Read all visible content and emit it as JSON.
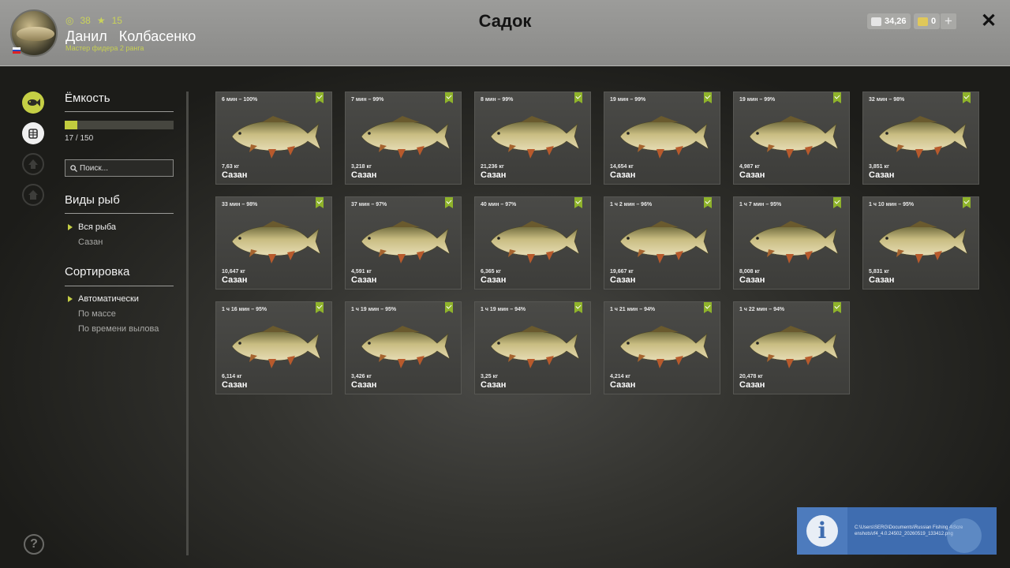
{
  "header": {
    "title": "Садок",
    "player_name": "Данил   Колбасенко",
    "rank": "Мастер фидера 2 ранга",
    "stat_coins": "38",
    "stat_stars": "15",
    "silver": "34,26",
    "gold": "0",
    "plus_label": "+",
    "close_label": "✕"
  },
  "nav_icons": [
    "fish-icon",
    "keepnet-icon",
    "upgrade-icon",
    "home-icon"
  ],
  "sidebar": {
    "capacity_title": "Ёмкость",
    "capacity_text": "17 / 150",
    "capacity_fraction": 0.113,
    "search_placeholder": "Поиск...",
    "species_title": "Виды рыб",
    "species": [
      "Вся рыба",
      "Сазан"
    ],
    "sort_title": "Сортировка",
    "sort": [
      "Автоматически",
      "По массе",
      "По времени вылова"
    ],
    "help_label": "?"
  },
  "fish": [
    {
      "time": "6 мин – 100%",
      "weight": "7,63 кг",
      "name": "Сазан"
    },
    {
      "time": "7 мин – 99%",
      "weight": "3,218 кг",
      "name": "Сазан"
    },
    {
      "time": "8 мин – 99%",
      "weight": "21,236 кг",
      "name": "Сазан"
    },
    {
      "time": "19 мин – 99%",
      "weight": "14,654 кг",
      "name": "Сазан"
    },
    {
      "time": "19 мин – 99%",
      "weight": "4,987 кг",
      "name": "Сазан"
    },
    {
      "time": "32 мин – 98%",
      "weight": "3,851 кг",
      "name": "Сазан"
    },
    {
      "time": "33 мин – 98%",
      "weight": "10,647 кг",
      "name": "Сазан"
    },
    {
      "time": "37 мин – 97%",
      "weight": "4,591 кг",
      "name": "Сазан"
    },
    {
      "time": "40 мин – 97%",
      "weight": "6,365 кг",
      "name": "Сазан"
    },
    {
      "time": "1 ч 2 мин – 96%",
      "weight": "19,667 кг",
      "name": "Сазан"
    },
    {
      "time": "1 ч 7 мин – 95%",
      "weight": "8,008 кг",
      "name": "Сазан"
    },
    {
      "time": "1 ч 10 мин – 95%",
      "weight": "5,831 кг",
      "name": "Сазан"
    },
    {
      "time": "1 ч 16 мин – 95%",
      "weight": "6,114 кг",
      "name": "Сазан"
    },
    {
      "time": "1 ч 19 мин – 95%",
      "weight": "3,426 кг",
      "name": "Сазан"
    },
    {
      "time": "1 ч 19 мин – 94%",
      "weight": "3,25 кг",
      "name": "Сазан"
    },
    {
      "time": "1 ч 21 мин – 94%",
      "weight": "4,214 кг",
      "name": "Сазан"
    },
    {
      "time": "1 ч 22 мин – 94%",
      "weight": "20,478 кг",
      "name": "Сазан"
    }
  ],
  "notification": {
    "text": "C:\\Users\\SERG\\Documents\\Russian Fishing 4\\Screenshots\\rf4_4.0.24502_20260519_133412.png",
    "icon": "info-icon"
  },
  "colors": {
    "accent": "#c5cf45",
    "bookmark": "#8fb32b",
    "notify": "#3f6db0"
  }
}
